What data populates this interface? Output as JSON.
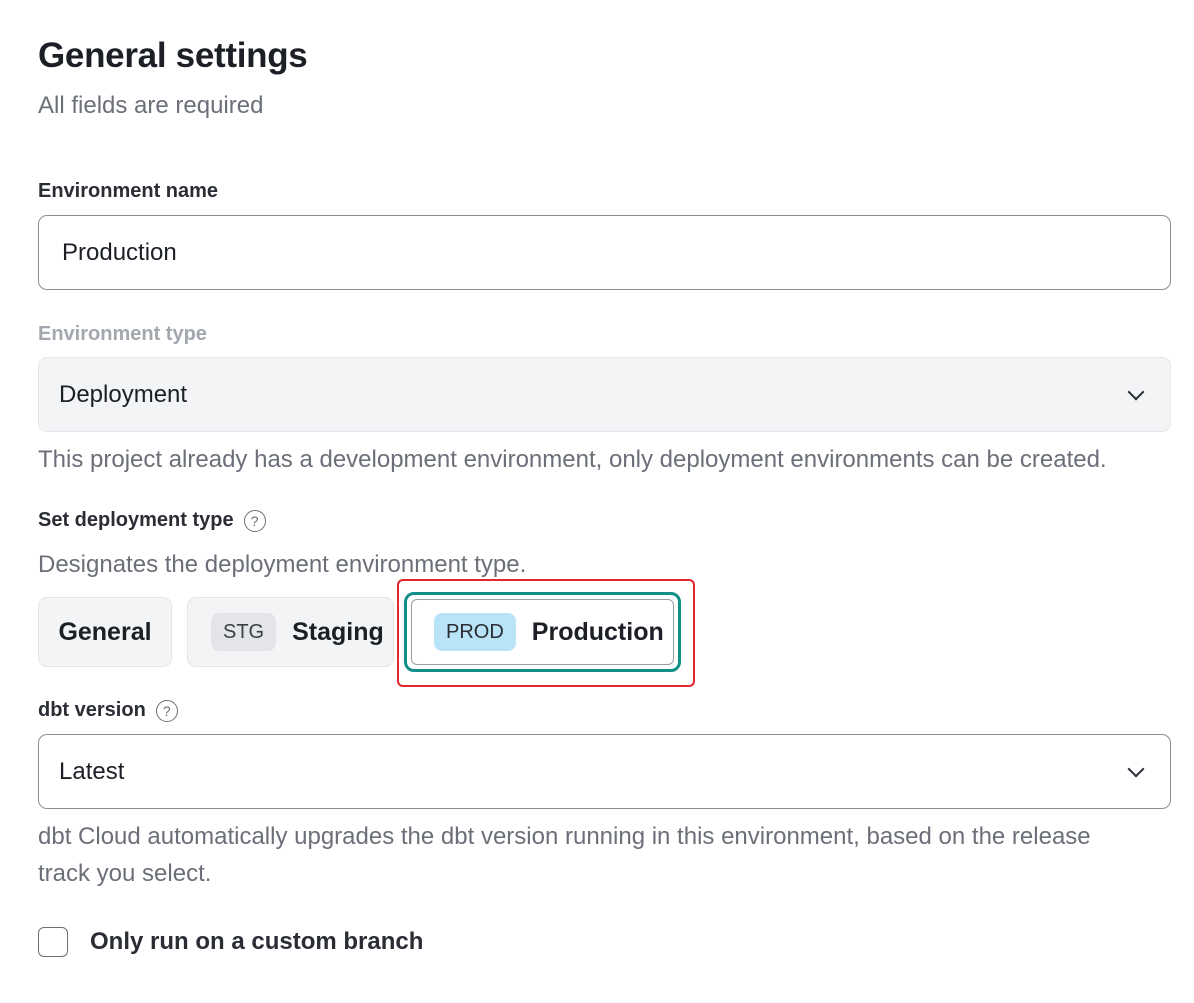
{
  "header": {
    "title": "General settings",
    "subtitle": "All fields are required"
  },
  "environment_name": {
    "label": "Environment name",
    "value": "Production"
  },
  "environment_type": {
    "label": "Environment type",
    "selected": "Deployment",
    "helper": "This project already has a development environment, only deployment environments can be created."
  },
  "deployment_type": {
    "label": "Set deployment type",
    "help_icon": "question-circle-icon",
    "helper": "Designates the deployment environment type.",
    "options": [
      {
        "tag": "",
        "label": "General"
      },
      {
        "tag": "STG",
        "label": "Staging"
      },
      {
        "tag": "PROD",
        "label": "Production"
      }
    ],
    "selected": "Production"
  },
  "dbt_version": {
    "label": "dbt version",
    "help_icon": "question-circle-icon",
    "selected": "Latest",
    "helper_line1": "dbt Cloud automatically upgrades the dbt version running in this environment, based on the release",
    "helper_line2": "track you select."
  },
  "custom_branch": {
    "label": "Only run on a custom branch",
    "checked": false
  },
  "colors": {
    "selected_border": "#138f8a",
    "annotation_border": "#e3262b",
    "prod_tag": "#b9e3f7"
  }
}
